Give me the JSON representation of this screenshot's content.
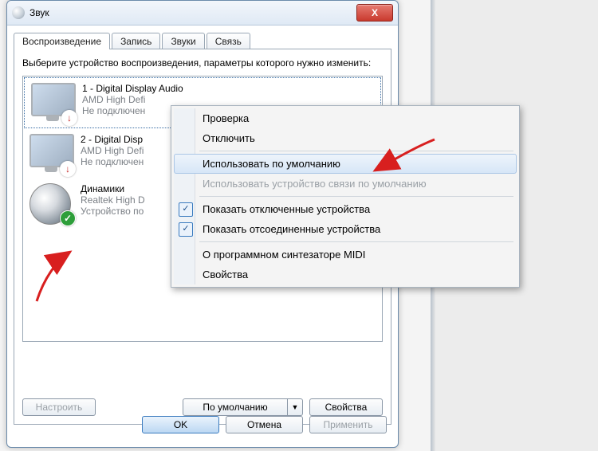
{
  "window": {
    "title": "Звук",
    "close_icon": "X"
  },
  "tabs": [
    "Воспроизведение",
    "Запись",
    "Звуки",
    "Связь"
  ],
  "instruction": "Выберите устройство воспроизведения, параметры которого нужно изменить:",
  "devices": [
    {
      "title": "1 - Digital Display Audio",
      "sub": "AMD High Defi",
      "status": "Не подключен",
      "badge": "down",
      "selected": true,
      "iconType": "monitor"
    },
    {
      "title": "2 - Digital Disp",
      "sub": "AMD High Defi",
      "status": "Не подключен",
      "badge": "down",
      "selected": false,
      "iconType": "monitor"
    },
    {
      "title": "Динамики",
      "sub": "Realtek High D",
      "status": "Устройство по",
      "badge": "ok",
      "selected": false,
      "iconType": "speaker"
    }
  ],
  "list_buttons": {
    "configure": "Настроить",
    "default": "По умолчанию",
    "properties": "Свойства"
  },
  "dialog_buttons": {
    "ok": "OK",
    "cancel": "Отмена",
    "apply": "Применить"
  },
  "context_menu": {
    "items": [
      {
        "label": "Проверка",
        "type": "item"
      },
      {
        "label": "Отключить",
        "type": "item"
      },
      {
        "type": "sep"
      },
      {
        "label": "Использовать по умолчанию",
        "type": "item",
        "highlight": true
      },
      {
        "label": "Использовать устройство связи по умолчанию",
        "type": "item",
        "disabled": true
      },
      {
        "type": "sep"
      },
      {
        "label": "Показать отключенные устройства",
        "type": "item",
        "checked": true
      },
      {
        "label": "Показать отсоединенные устройства",
        "type": "item",
        "checked": true
      },
      {
        "type": "sep"
      },
      {
        "label": "О программном синтезаторе MIDI",
        "type": "item"
      },
      {
        "label": "Свойства",
        "type": "item"
      }
    ]
  }
}
